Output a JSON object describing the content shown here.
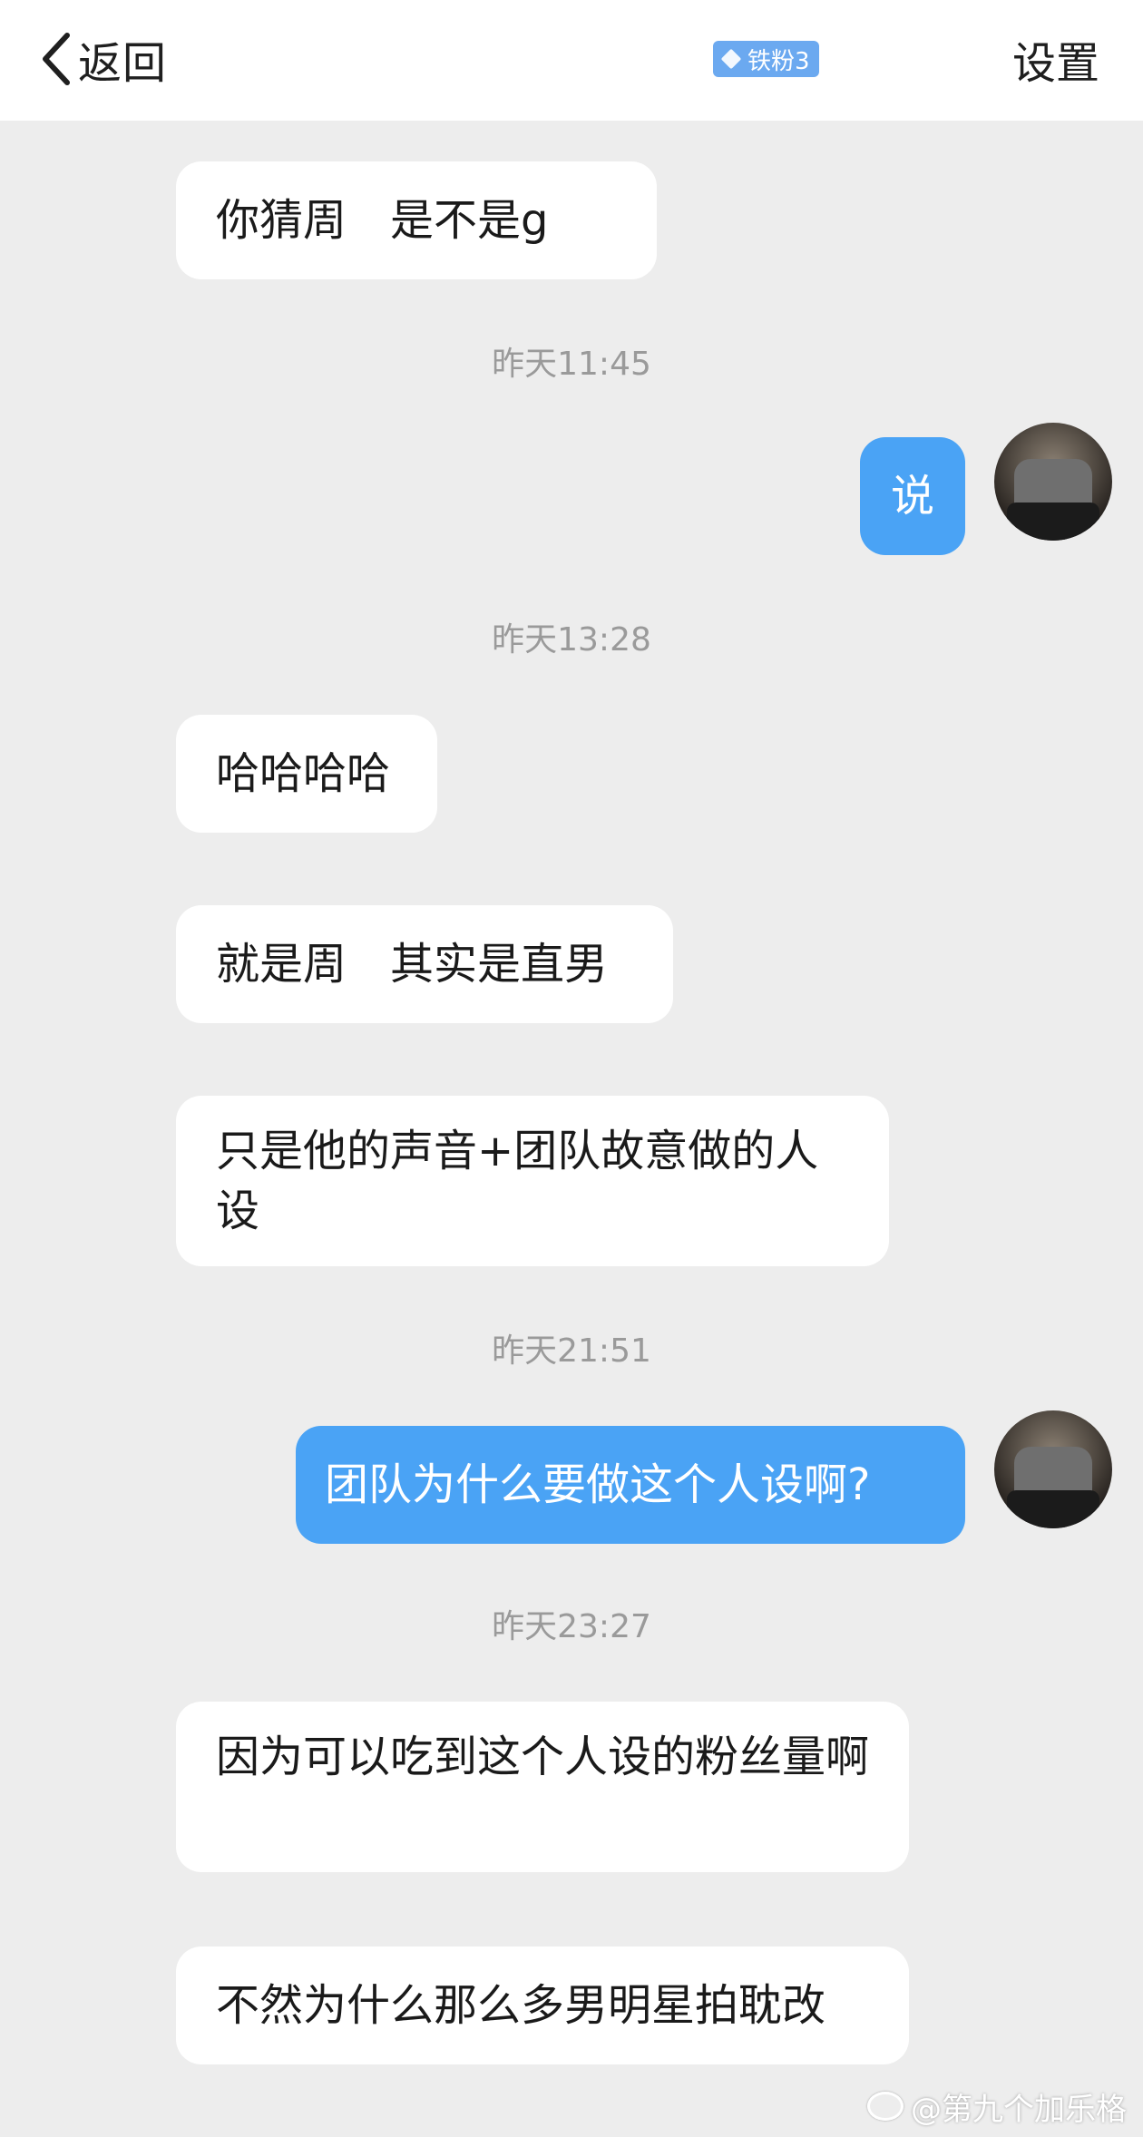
{
  "header": {
    "back_label": "返回",
    "badge_label": "铁粉3",
    "settings_label": "设置"
  },
  "messages": [
    {
      "side": "in",
      "text": "你猜周　是不是g"
    },
    {
      "time": "昨天11:45"
    },
    {
      "side": "out",
      "text": "说"
    },
    {
      "time": "昨天13:28"
    },
    {
      "side": "in",
      "text": "哈哈哈哈"
    },
    {
      "side": "in",
      "text": "就是周　其实是直男"
    },
    {
      "side": "in",
      "text": "只是他的声音+团队故意做的人设"
    },
    {
      "time": "昨天21:51"
    },
    {
      "side": "out",
      "text": "团队为什么要做这个人设啊?"
    },
    {
      "time": "昨天23:27"
    },
    {
      "side": "in",
      "text": "因为可以吃到这个人设的粉丝量啊"
    },
    {
      "side": "in",
      "text": "不然为什么那么多男明星拍耽改"
    }
  ],
  "watermark": "@第九个加乐格",
  "colors": {
    "background": "#ededed",
    "incoming_bubble": "#ffffff",
    "outgoing_bubble": "#4aa3f5",
    "badge": "#6ba9f0",
    "timestamp_text": "#9a9a9a"
  }
}
